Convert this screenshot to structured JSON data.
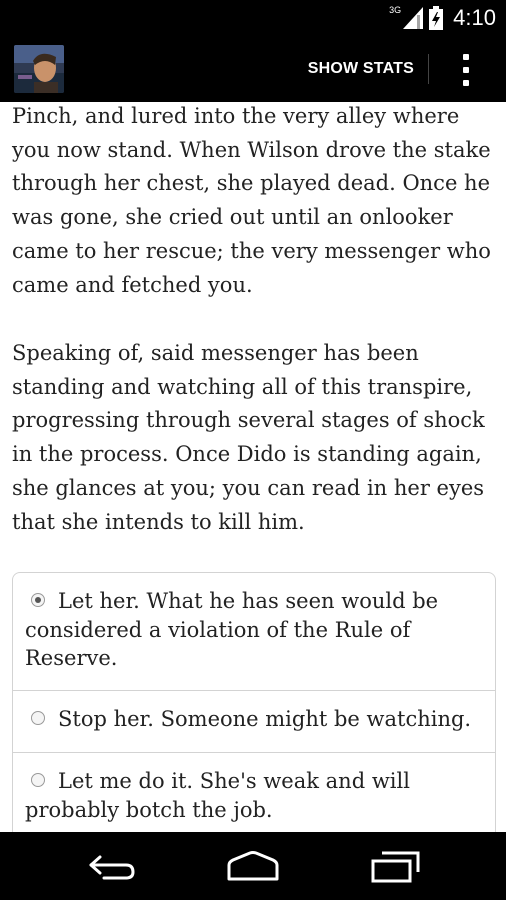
{
  "status_bar": {
    "network": "3G",
    "time": "4:10"
  },
  "app_bar": {
    "show_stats_label": "SHOW STATS",
    "app_icon": "character-portrait-icon",
    "overflow_icon": "overflow-menu-icon"
  },
  "story": {
    "paragraphs": [
      "Pinch, and lured into the very alley where you now stand. When Wilson drove the stake through her chest, she played dead. Once he was gone, she cried out until an onlooker came to her rescue; the very messenger who came and fetched you.",
      "Speaking of, said messenger has been standing and watching all of this transpire, progressing through several stages of shock in the process. Once Dido is standing again, she glances at you; you can read in her eyes that she intends to kill him."
    ]
  },
  "choices": [
    {
      "label": "Let her. What he has seen would be considered a violation of the Rule of Reserve.",
      "selected": true
    },
    {
      "label": "Stop her. Someone might be watching.",
      "selected": false
    },
    {
      "label": "Let me do it. She's weak and will probably botch the job.",
      "selected": false
    }
  ],
  "nav_bar": {
    "back_icon": "back-icon",
    "home_icon": "home-icon",
    "recents_icon": "recent-apps-icon"
  }
}
